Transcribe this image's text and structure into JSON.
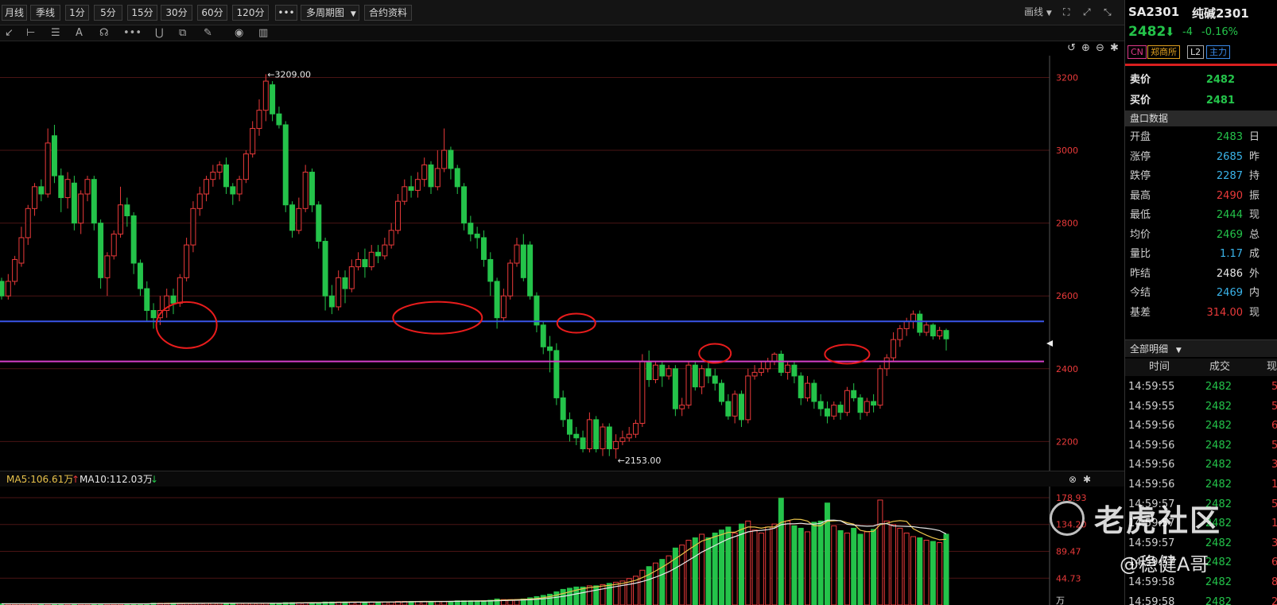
{
  "toolbar": {
    "periods": [
      "月线",
      "季线",
      "1分",
      "5分",
      "15分",
      "30分",
      "60分",
      "120分"
    ],
    "more": "•••",
    "multi_period": "多周期图",
    "contract_info": "合约资料",
    "draw_label": "画线"
  },
  "drawing_tools": [
    "cursor-icon",
    "range-measure-icon",
    "fibonacci-icon",
    "text-tool-icon",
    "brush-icon",
    "more-tools-icon",
    "magnet-icon",
    "copy-icon",
    "pencil-icon",
    "eye-icon",
    "trash-icon"
  ],
  "price_chart": {
    "high_label": "3209.00",
    "low_label": "2153.00",
    "y_ticks": [
      "3200",
      "3000",
      "2800",
      "2600",
      "2400",
      "2200"
    ],
    "annotations": {
      "blue_line_color": "#3a55e8",
      "magenta_line_color": "#d33fc8",
      "circle_color": "#e81c1c"
    }
  },
  "volume_chart": {
    "ma5_label": "MA5:106.61万",
    "ma10_label": "MA10:112.03万",
    "y_ticks": [
      "178.93",
      "134.20",
      "89.47",
      "44.73",
      "万"
    ]
  },
  "chart_data": {
    "type": "candlestick",
    "y_range": [
      2120,
      3260
    ],
    "high": 3209,
    "low": 2153,
    "support_level": 2530,
    "resistance_level": 2420,
    "volume_range": [
      0,
      178.93
    ],
    "candles": [
      {
        "o": 2640,
        "c": 2600,
        "h": 2650,
        "l": 2590,
        "v": 2
      },
      {
        "o": 2600,
        "c": 2640,
        "h": 2660,
        "l": 2590,
        "v": 2
      },
      {
        "o": 2640,
        "c": 2700,
        "h": 2710,
        "l": 2630,
        "v": 2
      },
      {
        "o": 2690,
        "c": 2760,
        "h": 2790,
        "l": 2680,
        "v": 2
      },
      {
        "o": 2760,
        "c": 2840,
        "h": 2850,
        "l": 2740,
        "v": 2
      },
      {
        "o": 2840,
        "c": 2900,
        "h": 2910,
        "l": 2820,
        "v": 2
      },
      {
        "o": 2900,
        "c": 2880,
        "h": 2920,
        "l": 2860,
        "v": 2
      },
      {
        "o": 2880,
        "c": 3020,
        "h": 3060,
        "l": 2870,
        "v": 2
      },
      {
        "o": 3040,
        "c": 2930,
        "h": 3070,
        "l": 2910,
        "v": 2
      },
      {
        "o": 2930,
        "c": 2870,
        "h": 2950,
        "l": 2830,
        "v": 2
      },
      {
        "o": 2870,
        "c": 2920,
        "h": 2940,
        "l": 2840,
        "v": 2
      },
      {
        "o": 2910,
        "c": 2800,
        "h": 2930,
        "l": 2780,
        "v": 2
      },
      {
        "o": 2800,
        "c": 2880,
        "h": 2890,
        "l": 2770,
        "v": 2
      },
      {
        "o": 2880,
        "c": 2920,
        "h": 2930,
        "l": 2860,
        "v": 2
      },
      {
        "o": 2920,
        "c": 2800,
        "h": 2930,
        "l": 2780,
        "v": 2
      },
      {
        "o": 2800,
        "c": 2650,
        "h": 2810,
        "l": 2620,
        "v": 2
      },
      {
        "o": 2650,
        "c": 2710,
        "h": 2720,
        "l": 2600,
        "v": 2
      },
      {
        "o": 2710,
        "c": 2770,
        "h": 2780,
        "l": 2700,
        "v": 2
      },
      {
        "o": 2770,
        "c": 2850,
        "h": 2900,
        "l": 2760,
        "v": 2
      },
      {
        "o": 2850,
        "c": 2820,
        "h": 2870,
        "l": 2790,
        "v": 2
      },
      {
        "o": 2820,
        "c": 2690,
        "h": 2830,
        "l": 2660,
        "v": 2
      },
      {
        "o": 2690,
        "c": 2620,
        "h": 2700,
        "l": 2600,
        "v": 2
      },
      {
        "o": 2620,
        "c": 2560,
        "h": 2640,
        "l": 2530,
        "v": 2
      },
      {
        "o": 2560,
        "c": 2540,
        "h": 2580,
        "l": 2510,
        "v": 3
      },
      {
        "o": 2540,
        "c": 2560,
        "h": 2600,
        "l": 2520,
        "v": 3
      },
      {
        "o": 2560,
        "c": 2600,
        "h": 2620,
        "l": 2540,
        "v": 3
      },
      {
        "o": 2600,
        "c": 2580,
        "h": 2620,
        "l": 2550,
        "v": 3
      },
      {
        "o": 2580,
        "c": 2650,
        "h": 2660,
        "l": 2570,
        "v": 3
      },
      {
        "o": 2650,
        "c": 2740,
        "h": 2760,
        "l": 2640,
        "v": 3
      },
      {
        "o": 2740,
        "c": 2840,
        "h": 2860,
        "l": 2720,
        "v": 3
      },
      {
        "o": 2840,
        "c": 2880,
        "h": 2900,
        "l": 2820,
        "v": 3
      },
      {
        "o": 2880,
        "c": 2920,
        "h": 2930,
        "l": 2860,
        "v": 3
      },
      {
        "o": 2920,
        "c": 2940,
        "h": 2960,
        "l": 2900,
        "v": 3
      },
      {
        "o": 2940,
        "c": 2960,
        "h": 2970,
        "l": 2920,
        "v": 3
      },
      {
        "o": 2960,
        "c": 2900,
        "h": 2980,
        "l": 2880,
        "v": 3
      },
      {
        "o": 2900,
        "c": 2880,
        "h": 2910,
        "l": 2850,
        "v": 3
      },
      {
        "o": 2880,
        "c": 2920,
        "h": 2930,
        "l": 2860,
        "v": 3
      },
      {
        "o": 2920,
        "c": 2990,
        "h": 3000,
        "l": 2910,
        "v": 3
      },
      {
        "o": 2990,
        "c": 3060,
        "h": 3080,
        "l": 2980,
        "v": 3
      },
      {
        "o": 3060,
        "c": 3110,
        "h": 3140,
        "l": 3040,
        "v": 3
      },
      {
        "o": 3110,
        "c": 3190,
        "h": 3209,
        "l": 3080,
        "v": 3
      },
      {
        "o": 3180,
        "c": 3100,
        "h": 3190,
        "l": 3080,
        "v": 3
      },
      {
        "o": 3100,
        "c": 3070,
        "h": 3120,
        "l": 3060,
        "v": 3
      },
      {
        "o": 3070,
        "c": 2850,
        "h": 3080,
        "l": 2830,
        "v": 4
      },
      {
        "o": 2850,
        "c": 2780,
        "h": 2860,
        "l": 2760,
        "v": 4
      },
      {
        "o": 2780,
        "c": 2840,
        "h": 2870,
        "l": 2770,
        "v": 4
      },
      {
        "o": 2840,
        "c": 2940,
        "h": 2960,
        "l": 2830,
        "v": 4
      },
      {
        "o": 2940,
        "c": 2850,
        "h": 2950,
        "l": 2830,
        "v": 4
      },
      {
        "o": 2850,
        "c": 2750,
        "h": 2860,
        "l": 2730,
        "v": 4
      },
      {
        "o": 2750,
        "c": 2600,
        "h": 2760,
        "l": 2560,
        "v": 5
      },
      {
        "o": 2600,
        "c": 2570,
        "h": 2630,
        "l": 2550,
        "v": 5
      },
      {
        "o": 2570,
        "c": 2650,
        "h": 2670,
        "l": 2560,
        "v": 5
      },
      {
        "o": 2650,
        "c": 2620,
        "h": 2670,
        "l": 2580,
        "v": 5
      },
      {
        "o": 2620,
        "c": 2680,
        "h": 2700,
        "l": 2610,
        "v": 5
      },
      {
        "o": 2680,
        "c": 2700,
        "h": 2720,
        "l": 2670,
        "v": 5
      },
      {
        "o": 2700,
        "c": 2680,
        "h": 2730,
        "l": 2650,
        "v": 5
      },
      {
        "o": 2680,
        "c": 2720,
        "h": 2740,
        "l": 2670,
        "v": 5
      },
      {
        "o": 2720,
        "c": 2710,
        "h": 2740,
        "l": 2690,
        "v": 5
      },
      {
        "o": 2710,
        "c": 2740,
        "h": 2760,
        "l": 2700,
        "v": 5
      },
      {
        "o": 2740,
        "c": 2780,
        "h": 2800,
        "l": 2730,
        "v": 5
      },
      {
        "o": 2780,
        "c": 2860,
        "h": 2880,
        "l": 2770,
        "v": 6
      },
      {
        "o": 2860,
        "c": 2900,
        "h": 2920,
        "l": 2850,
        "v": 6
      },
      {
        "o": 2900,
        "c": 2890,
        "h": 2930,
        "l": 2870,
        "v": 6
      },
      {
        "o": 2890,
        "c": 2920,
        "h": 2940,
        "l": 2870,
        "v": 6
      },
      {
        "o": 2920,
        "c": 2960,
        "h": 2980,
        "l": 2900,
        "v": 6
      },
      {
        "o": 2960,
        "c": 2900,
        "h": 2970,
        "l": 2880,
        "v": 6
      },
      {
        "o": 2900,
        "c": 2950,
        "h": 3000,
        "l": 2890,
        "v": 6
      },
      {
        "o": 2950,
        "c": 3000,
        "h": 3060,
        "l": 2940,
        "v": 6
      },
      {
        "o": 3000,
        "c": 2950,
        "h": 3010,
        "l": 2920,
        "v": 6
      },
      {
        "o": 2950,
        "c": 2900,
        "h": 2960,
        "l": 2880,
        "v": 7
      },
      {
        "o": 2900,
        "c": 2800,
        "h": 2910,
        "l": 2780,
        "v": 7
      },
      {
        "o": 2800,
        "c": 2770,
        "h": 2820,
        "l": 2750,
        "v": 7
      },
      {
        "o": 2770,
        "c": 2760,
        "h": 2790,
        "l": 2730,
        "v": 7
      },
      {
        "o": 2760,
        "c": 2700,
        "h": 2780,
        "l": 2680,
        "v": 7
      },
      {
        "o": 2700,
        "c": 2640,
        "h": 2720,
        "l": 2600,
        "v": 8
      },
      {
        "o": 2640,
        "c": 2540,
        "h": 2650,
        "l": 2510,
        "v": 10
      },
      {
        "o": 2540,
        "c": 2600,
        "h": 2620,
        "l": 2530,
        "v": 9
      },
      {
        "o": 2600,
        "c": 2690,
        "h": 2700,
        "l": 2590,
        "v": 9
      },
      {
        "o": 2690,
        "c": 2740,
        "h": 2760,
        "l": 2680,
        "v": 9
      },
      {
        "o": 2740,
        "c": 2650,
        "h": 2770,
        "l": 2640,
        "v": 10
      },
      {
        "o": 2740,
        "c": 2600,
        "h": 2750,
        "l": 2590,
        "v": 12
      },
      {
        "o": 2600,
        "c": 2520,
        "h": 2610,
        "l": 2500,
        "v": 14
      },
      {
        "o": 2520,
        "c": 2460,
        "h": 2530,
        "l": 2440,
        "v": 16
      },
      {
        "o": 2460,
        "c": 2450,
        "h": 2490,
        "l": 2390,
        "v": 18
      },
      {
        "o": 2450,
        "c": 2320,
        "h": 2470,
        "l": 2300,
        "v": 22
      },
      {
        "o": 2320,
        "c": 2260,
        "h": 2340,
        "l": 2240,
        "v": 26
      },
      {
        "o": 2260,
        "c": 2220,
        "h": 2280,
        "l": 2200,
        "v": 28
      },
      {
        "o": 2220,
        "c": 2210,
        "h": 2240,
        "l": 2190,
        "v": 30
      },
      {
        "o": 2210,
        "c": 2180,
        "h": 2230,
        "l": 2170,
        "v": 30
      },
      {
        "o": 2180,
        "c": 2260,
        "h": 2280,
        "l": 2170,
        "v": 32
      },
      {
        "o": 2260,
        "c": 2180,
        "h": 2270,
        "l": 2170,
        "v": 32
      },
      {
        "o": 2180,
        "c": 2240,
        "h": 2250,
        "l": 2160,
        "v": 34
      },
      {
        "o": 2240,
        "c": 2180,
        "h": 2250,
        "l": 2160,
        "v": 36
      },
      {
        "o": 2180,
        "c": 2200,
        "h": 2220,
        "l": 2153,
        "v": 38
      },
      {
        "o": 2200,
        "c": 2210,
        "h": 2230,
        "l": 2190,
        "v": 40
      },
      {
        "o": 2210,
        "c": 2220,
        "h": 2240,
        "l": 2200,
        "v": 44
      },
      {
        "o": 2220,
        "c": 2250,
        "h": 2260,
        "l": 2210,
        "v": 48
      },
      {
        "o": 2250,
        "c": 2420,
        "h": 2440,
        "l": 2240,
        "v": 58
      },
      {
        "o": 2420,
        "c": 2370,
        "h": 2450,
        "l": 2350,
        "v": 64
      },
      {
        "o": 2370,
        "c": 2410,
        "h": 2420,
        "l": 2360,
        "v": 70
      },
      {
        "o": 2410,
        "c": 2380,
        "h": 2420,
        "l": 2350,
        "v": 76
      },
      {
        "o": 2380,
        "c": 2400,
        "h": 2410,
        "l": 2370,
        "v": 82
      },
      {
        "o": 2400,
        "c": 2290,
        "h": 2410,
        "l": 2270,
        "v": 95
      },
      {
        "o": 2290,
        "c": 2300,
        "h": 2320,
        "l": 2270,
        "v": 100
      },
      {
        "o": 2300,
        "c": 2410,
        "h": 2420,
        "l": 2290,
        "v": 108
      },
      {
        "o": 2410,
        "c": 2350,
        "h": 2420,
        "l": 2340,
        "v": 112
      },
      {
        "o": 2350,
        "c": 2400,
        "h": 2410,
        "l": 2330,
        "v": 118
      },
      {
        "o": 2400,
        "c": 2380,
        "h": 2420,
        "l": 2360,
        "v": 112
      },
      {
        "o": 2380,
        "c": 2360,
        "h": 2400,
        "l": 2340,
        "v": 120
      },
      {
        "o": 2360,
        "c": 2310,
        "h": 2370,
        "l": 2300,
        "v": 125
      },
      {
        "o": 2310,
        "c": 2270,
        "h": 2330,
        "l": 2260,
        "v": 130
      },
      {
        "o": 2270,
        "c": 2330,
        "h": 2340,
        "l": 2250,
        "v": 120
      },
      {
        "o": 2330,
        "c": 2260,
        "h": 2340,
        "l": 2240,
        "v": 135
      },
      {
        "o": 2260,
        "c": 2380,
        "h": 2400,
        "l": 2250,
        "v": 140
      },
      {
        "o": 2380,
        "c": 2390,
        "h": 2410,
        "l": 2370,
        "v": 125
      },
      {
        "o": 2390,
        "c": 2400,
        "h": 2420,
        "l": 2380,
        "v": 120
      },
      {
        "o": 2400,
        "c": 2420,
        "h": 2430,
        "l": 2390,
        "v": 130
      },
      {
        "o": 2420,
        "c": 2440,
        "h": 2445,
        "l": 2410,
        "v": 135
      },
      {
        "o": 2440,
        "c": 2390,
        "h": 2450,
        "l": 2380,
        "v": 178
      },
      {
        "o": 2390,
        "c": 2410,
        "h": 2420,
        "l": 2370,
        "v": 140
      },
      {
        "o": 2410,
        "c": 2380,
        "h": 2420,
        "l": 2360,
        "v": 132
      },
      {
        "o": 2380,
        "c": 2320,
        "h": 2390,
        "l": 2300,
        "v": 128
      },
      {
        "o": 2320,
        "c": 2360,
        "h": 2380,
        "l": 2310,
        "v": 122
      },
      {
        "o": 2360,
        "c": 2310,
        "h": 2370,
        "l": 2290,
        "v": 138
      },
      {
        "o": 2310,
        "c": 2290,
        "h": 2330,
        "l": 2270,
        "v": 140
      },
      {
        "o": 2290,
        "c": 2270,
        "h": 2310,
        "l": 2250,
        "v": 170
      },
      {
        "o": 2270,
        "c": 2300,
        "h": 2310,
        "l": 2260,
        "v": 132
      },
      {
        "o": 2300,
        "c": 2280,
        "h": 2310,
        "l": 2260,
        "v": 124
      },
      {
        "o": 2280,
        "c": 2340,
        "h": 2350,
        "l": 2270,
        "v": 120
      },
      {
        "o": 2340,
        "c": 2320,
        "h": 2360,
        "l": 2310,
        "v": 128
      },
      {
        "o": 2320,
        "c": 2280,
        "h": 2330,
        "l": 2260,
        "v": 118
      },
      {
        "o": 2280,
        "c": 2310,
        "h": 2320,
        "l": 2270,
        "v": 122
      },
      {
        "o": 2310,
        "c": 2300,
        "h": 2330,
        "l": 2280,
        "v": 126
      },
      {
        "o": 2300,
        "c": 2400,
        "h": 2410,
        "l": 2290,
        "v": 175
      },
      {
        "o": 2400,
        "c": 2430,
        "h": 2440,
        "l": 2380,
        "v": 140
      },
      {
        "o": 2430,
        "c": 2480,
        "h": 2500,
        "l": 2420,
        "v": 134
      },
      {
        "o": 2480,
        "c": 2510,
        "h": 2520,
        "l": 2460,
        "v": 128
      },
      {
        "o": 2510,
        "c": 2530,
        "h": 2540,
        "l": 2490,
        "v": 120
      },
      {
        "o": 2530,
        "c": 2550,
        "h": 2560,
        "l": 2510,
        "v": 114
      },
      {
        "o": 2550,
        "c": 2500,
        "h": 2560,
        "l": 2490,
        "v": 112
      },
      {
        "o": 2500,
        "c": 2520,
        "h": 2530,
        "l": 2490,
        "v": 108
      },
      {
        "o": 2520,
        "c": 2490,
        "h": 2525,
        "l": 2480,
        "v": 106
      },
      {
        "o": 2490,
        "c": 2505,
        "h": 2515,
        "l": 2480,
        "v": 104
      },
      {
        "o": 2505,
        "c": 2482,
        "h": 2510,
        "l": 2450,
        "v": 118
      }
    ]
  },
  "right_panel": {
    "symbol": "SA2301",
    "name": "纯碱2301",
    "last_price": "2482",
    "arrow": "⬇",
    "change": "-4",
    "change_pct": "-0.16%",
    "tags": [
      "CN",
      "郑商所",
      "L2",
      "主力"
    ],
    "sell_label": "卖价",
    "sell_value": "2482",
    "buy_label": "买价",
    "buy_value": "2481",
    "section_title": "盘口数据",
    "rows": [
      {
        "k": "开盘",
        "v": "2483",
        "c": "green",
        "k2": "日"
      },
      {
        "k": "涨停",
        "v": "2685",
        "c": "cyan",
        "k2": "昨"
      },
      {
        "k": "跌停",
        "v": "2287",
        "c": "cyan",
        "k2": "持"
      },
      {
        "k": "最高",
        "v": "2490",
        "c": "red",
        "k2": "振"
      },
      {
        "k": "最低",
        "v": "2444",
        "c": "green",
        "k2": "现"
      },
      {
        "k": "均价",
        "v": "2469",
        "c": "green",
        "k2": "总"
      },
      {
        "k": "量比",
        "v": "1.17",
        "c": "cyan",
        "k2": "成"
      },
      {
        "k": "昨结",
        "v": "2486",
        "c": "white",
        "k2": "外"
      },
      {
        "k": "今结",
        "v": "2469",
        "c": "cyan",
        "k2": "内"
      },
      {
        "k": "基差",
        "v": "314.00",
        "c": "red",
        "k2": "现"
      }
    ],
    "detail_tab": "全部明细",
    "tick_headers": [
      "时间",
      "成交",
      "现"
    ],
    "ticks": [
      {
        "t": "14:59:55",
        "p": "2482",
        "v": "5"
      },
      {
        "t": "14:59:55",
        "p": "2482",
        "v": "5"
      },
      {
        "t": "14:59:56",
        "p": "2482",
        "v": "6"
      },
      {
        "t": "14:59:56",
        "p": "2482",
        "v": "5"
      },
      {
        "t": "14:59:56",
        "p": "2482",
        "v": "3"
      },
      {
        "t": "14:59:56",
        "p": "2482",
        "v": "1"
      },
      {
        "t": "14:59:57",
        "p": "2482",
        "v": "5"
      },
      {
        "t": "14:59:57",
        "p": "2482",
        "v": "1"
      },
      {
        "t": "14:59:57",
        "p": "2482",
        "v": "3"
      },
      {
        "t": "14:59:57",
        "p": "2482",
        "v": "6"
      },
      {
        "t": "14:59:58",
        "p": "2482",
        "v": "8"
      },
      {
        "t": "14:59:58",
        "p": "2482",
        "v": "2"
      }
    ]
  },
  "watermark": {
    "brand": "老虎社区",
    "author": "@稳健A哥"
  }
}
